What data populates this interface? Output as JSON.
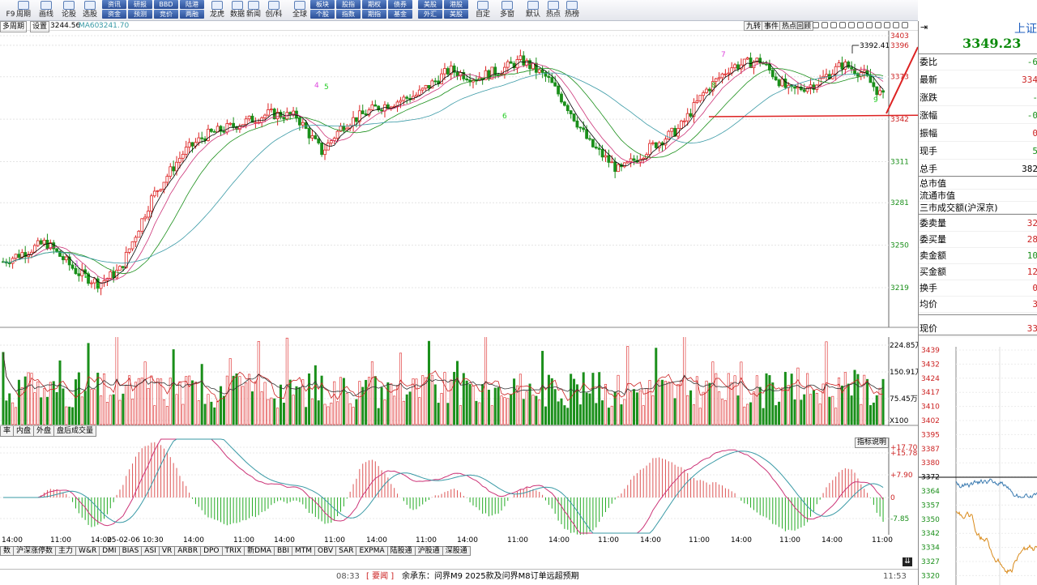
{
  "toolbar": {
    "items": [
      {
        "label": "F9",
        "icon": "function-icon",
        "small": true
      },
      {
        "label": "周期",
        "icon": "period-icon"
      },
      {
        "label": "画线",
        "icon": "draw-line-icon"
      },
      {
        "label": "论股",
        "icon": "forum-icon"
      },
      {
        "label": "选股",
        "icon": "stock-pick-icon"
      },
      {
        "label": "龙虎",
        "icon": "dragon-tiger-icon"
      },
      {
        "label": "数据",
        "icon": "data-icon"
      },
      {
        "label": "新闻",
        "icon": "news-icon"
      },
      {
        "label": "创/科",
        "icon": "chuang-ke-icon"
      },
      {
        "label": "全球",
        "icon": "globe-icon"
      },
      {
        "label": "自定",
        "icon": "custom-icon"
      },
      {
        "label": "多窗",
        "icon": "multi-window-icon"
      },
      {
        "label": "默认",
        "icon": "home-icon"
      },
      {
        "label": "热点",
        "icon": "hot-icon"
      },
      {
        "label": "热榜",
        "icon": "hot-list-icon"
      }
    ],
    "grid_buttons": [
      {
        "top": "资讯",
        "bottom": "资金"
      },
      {
        "top": "研报",
        "bottom": "预测"
      },
      {
        "top": "BBD",
        "bottom": "竞价"
      },
      {
        "top": "陆港",
        "bottom": "两融"
      },
      {
        "top": "板块",
        "bottom": "个股"
      },
      {
        "top": "股指",
        "bottom": "指数"
      },
      {
        "top": "期权",
        "bottom": "期指"
      },
      {
        "top": "债券",
        "bottom": "基金"
      },
      {
        "top": "美股",
        "bottom": "外汇"
      },
      {
        "top": "港股",
        "bottom": "美股"
      }
    ]
  },
  "status": {
    "tab_multi": "多周期",
    "tab_settings": "设置",
    "ma_a": "3244.56",
    "ma60_label": "MA60:",
    "ma60_value": "3241.70"
  },
  "top_right_tabs": [
    "九转",
    "事件",
    "热点回顾"
  ],
  "price_axis": [
    "3403",
    "3396",
    "3373",
    "3342",
    "3311",
    "3281",
    "3250",
    "3219"
  ],
  "annotation_high": "3392.41",
  "volume_axis": [
    "224.85万",
    "150.91万",
    "75.45万",
    "X100"
  ],
  "vol_tabs": [
    "率",
    "内盘",
    "外盘",
    "盘后成交量"
  ],
  "macd_axis": [
    "17.70",
    "15.78",
    "7.90",
    "0",
    "-7.85"
  ],
  "explain_btn": "指标说明",
  "time_axis": [
    "14:00",
    "11:00",
    "14:00",
    "25-02-06 10:30",
    "14:00",
    "11:00",
    "14:00",
    "11:00",
    "14:00",
    "11:00",
    "14:00",
    "11:00",
    "14:00",
    "11:00",
    "14:00",
    "11:00",
    "14:00",
    "11:00",
    "14:00",
    "11:00"
  ],
  "indicator_tabs": [
    "数",
    "沪深涨停数",
    "主力",
    "W&R",
    "DMI",
    "BIAS",
    "ASI",
    "VR",
    "ARBR",
    "DPO",
    "TRIX",
    "新DMA",
    "BBI",
    "MTM",
    "OBV",
    "SAR",
    "EXPMA",
    "陆股通",
    "沪股通",
    "深股通"
  ],
  "bottom": {
    "time1": "08:33",
    "tag": "[ 要闻 ]",
    "headline": "余承东：问界M9 2025款及问界M8订单远超预期",
    "time2": "11:53"
  },
  "side": {
    "name": "上证",
    "price": "3349.23",
    "rows": [
      {
        "k": "委比",
        "v": "-6"
      },
      {
        "k": "最新",
        "v": "334"
      },
      {
        "k": "涨跌",
        "v": "-"
      },
      {
        "k": "涨幅",
        "v": "-0"
      },
      {
        "k": "振幅",
        "v": "0"
      },
      {
        "k": "现手",
        "v": "5"
      },
      {
        "k": "总手",
        "v": "382"
      },
      {
        "k": "总市值",
        "v": ""
      },
      {
        "k": "流通市值",
        "v": ""
      },
      {
        "k": "三市成交额(沪深京)",
        "v": ""
      },
      {
        "k": "委卖量",
        "v": "32"
      },
      {
        "k": "委买量",
        "v": "28"
      },
      {
        "k": "卖金额",
        "v": "10"
      },
      {
        "k": "买金额",
        "v": "12"
      },
      {
        "k": "换手",
        "v": "0"
      },
      {
        "k": "均价",
        "v": "3"
      },
      {
        "k": "现价",
        "v": "33"
      }
    ],
    "mini_axis": [
      "3439",
      "3432",
      "3424",
      "3417",
      "3410",
      "3402",
      "3395",
      "3387",
      "3380",
      "3372",
      "3364",
      "3357",
      "3350",
      "3342",
      "3334",
      "3327",
      "3320"
    ]
  },
  "colors": {
    "up": "#d22",
    "down": "#1a8f1a",
    "ma5": "#000",
    "ma10": "#c37",
    "ma20": "#1a8f1a",
    "ma60": "#3a9aa6",
    "arrow": "#d22"
  }
}
